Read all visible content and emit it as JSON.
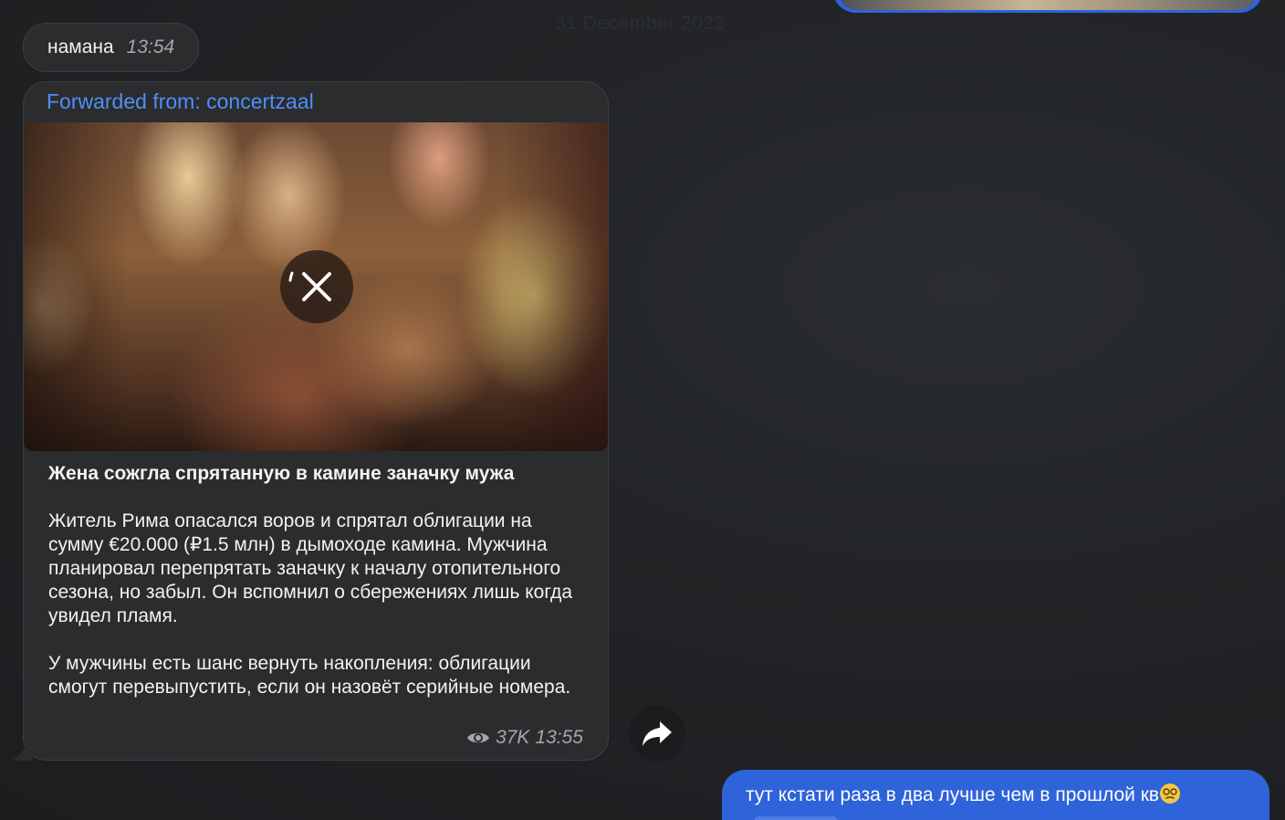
{
  "date_separator": "31 December 2022",
  "messages": {
    "short_incoming": {
      "text": "намана",
      "time": "13:54"
    },
    "forwarded": {
      "forwarded_label": "Forwarded from: concertzaal",
      "title": "Жена сожгла спрятанную в камине заначку мужа",
      "body_paragraph_1": "Житель Рима опасался воров и спрятал облигации на сумму €20.000 (₽1.5 млн) в дымоходе камина. Мужчина планировал перепрятать заначку к началу отопительного сезона, но забыл. Он вспомнил о сбережениях лишь когда увидел пламя.",
      "body_paragraph_2": "У мужчины есть шанс вернуть накопления: облигации смогут перевыпустить, если он назовёт серийные номера.",
      "views": "37K",
      "time": "13:55",
      "media_icon": "cancel-download-icon",
      "views_icon": "eye-icon"
    },
    "outgoing": {
      "text": "тут кстати раза в два лучше чем в прошлой кв",
      "emoji": "woozy-face-emoji"
    }
  },
  "actions": {
    "share_icon": "share-arrow-icon"
  },
  "colors": {
    "background": "#1e2022",
    "incoming_bubble": "#2b2c2e",
    "outgoing_bubble": "#2f63d9",
    "link_accent": "#4f8ff7",
    "meta_text": "#a3a6ab"
  }
}
